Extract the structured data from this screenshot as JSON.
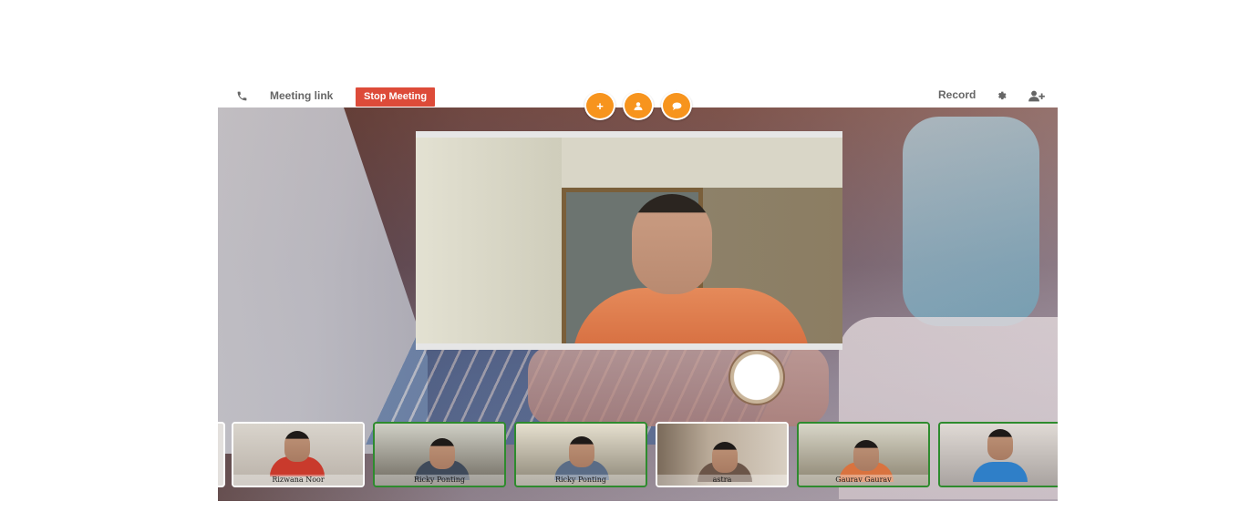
{
  "toolbar": {
    "phone_icon": "phone-icon",
    "meeting_link_label": "Meeting link",
    "stop_meeting_label": "Stop Meeting",
    "record_label": "Record",
    "settings_icon": "gear-icon",
    "add_user_icon": "add-user-icon",
    "stop_color": "#dd4b39"
  },
  "actions": [
    {
      "icon": "plus-icon",
      "glyph": "+"
    },
    {
      "icon": "user-icon",
      "glyph": "●"
    },
    {
      "icon": "chat-icon",
      "glyph": "●"
    }
  ],
  "accent_color": "#f7941d",
  "participants": [
    {
      "name": "Rizwana Noor",
      "active": false
    },
    {
      "name": "Ricky Ponting",
      "active": true
    },
    {
      "name": "Ricky Ponting",
      "active": true
    },
    {
      "name": "astra",
      "active": false
    },
    {
      "name": "Gaurav Gaurav",
      "active": true
    },
    {
      "name": "",
      "active": true
    }
  ]
}
